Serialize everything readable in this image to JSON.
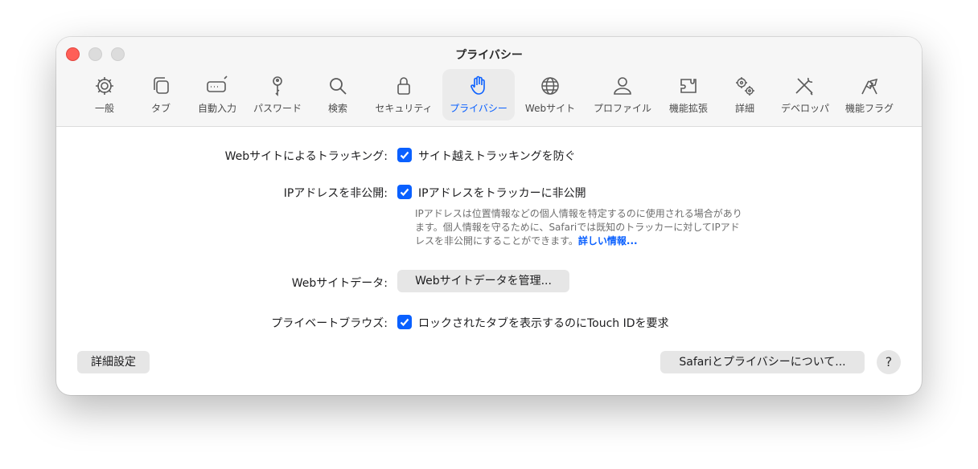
{
  "window": {
    "title": "プライバシー"
  },
  "toolbar": {
    "items": [
      {
        "label": "一般",
        "icon": "gear-icon"
      },
      {
        "label": "タブ",
        "icon": "tabs-icon"
      },
      {
        "label": "自動入力",
        "icon": "autofill-icon"
      },
      {
        "label": "パスワード",
        "icon": "key-icon"
      },
      {
        "label": "検索",
        "icon": "search-icon"
      },
      {
        "label": "セキュリティ",
        "icon": "lock-icon"
      },
      {
        "label": "プライバシー",
        "icon": "hand-icon",
        "active": true
      },
      {
        "label": "Webサイト",
        "icon": "globe-icon"
      },
      {
        "label": "プロファイル",
        "icon": "person-icon"
      },
      {
        "label": "機能拡張",
        "icon": "puzzle-icon"
      },
      {
        "label": "詳細",
        "icon": "gears-icon"
      },
      {
        "label": "デベロッパ",
        "icon": "tools-icon"
      },
      {
        "label": "機能フラグ",
        "icon": "flags-icon"
      }
    ]
  },
  "settings": {
    "tracking": {
      "label": "Webサイトによるトラッキング:",
      "option": "サイト越えトラッキングを防ぐ",
      "checked": true
    },
    "ip": {
      "label": "IPアドレスを非公開:",
      "option": "IPアドレスをトラッカーに非公開",
      "checked": true,
      "description_line1": "IPアドレスは位置情報などの個人情報を特定するのに使用される場合があり",
      "description_line2": "ます。個人情報を守るために、Safariでは既知のトラッカーに対してIPアド",
      "description_line3": "レスを非公開にすることができます。",
      "more_link": "詳しい情報..."
    },
    "website_data": {
      "label": "Webサイトデータ:",
      "button": "Webサイトデータを管理..."
    },
    "private": {
      "label": "プライベートブラウズ:",
      "option": "ロックされたタブを表示するのにTouch IDを要求",
      "checked": true
    }
  },
  "footer": {
    "advanced_button": "詳細設定",
    "about_button": "Safariとプライバシーについて...",
    "help_button": "?"
  },
  "colors": {
    "accent": "#0a60ff",
    "close": "#ff5f57"
  }
}
